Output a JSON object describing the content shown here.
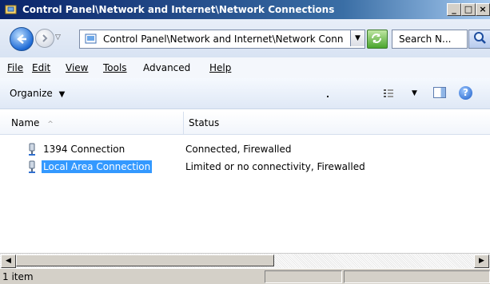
{
  "window": {
    "title": "Control Panel\\Network and Internet\\Network Connections",
    "controls": [
      "_",
      "□",
      "×"
    ]
  },
  "address": {
    "path": "Control Panel\\Network and Internet\\Network Conn",
    "search_placeholder": "Search N..."
  },
  "menu": {
    "items": [
      {
        "label": "File",
        "underline": "F"
      },
      {
        "label": "Edit",
        "underline": "E"
      },
      {
        "label": "View",
        "underline": "V"
      },
      {
        "label": "Tools",
        "underline": "T"
      },
      {
        "label": "Advanced",
        "underline": "n"
      },
      {
        "label": "Help",
        "underline": "H"
      }
    ]
  },
  "toolbar": {
    "organize_label": "Organize",
    "dropdown_glyph": "▼",
    "dot": ".",
    "help_glyph": "?"
  },
  "columns": {
    "name": "Name",
    "name_sort_glyph": "^",
    "status": "Status"
  },
  "items": [
    {
      "name": "1394 Connection",
      "status": "Connected, Firewalled",
      "selected": false
    },
    {
      "name": "Local Area Connection",
      "status": "Limited or no connectivity, Firewalled",
      "selected": true
    }
  ],
  "statusbar": {
    "item_count": "1 item"
  },
  "colors": {
    "title_gradient_start": "#0a246a",
    "selection": "#3399ff"
  }
}
